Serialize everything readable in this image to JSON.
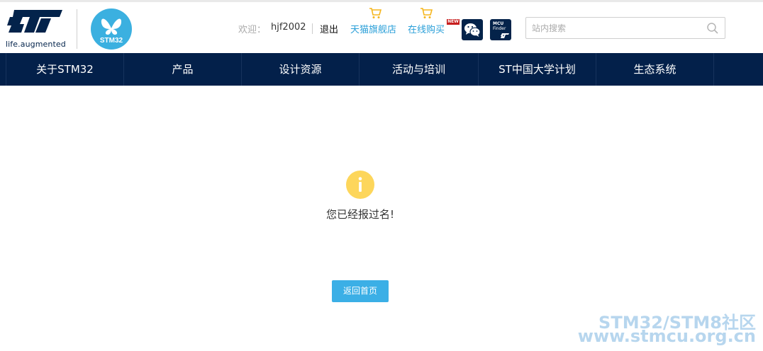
{
  "header": {
    "tagline": "life.augmented",
    "stm_logo_text": "STM32",
    "welcome_label": "欢迎：",
    "username": "hjf2002",
    "logout_label": "退出",
    "shop_links": [
      {
        "label": "天猫旗舰店",
        "icon": "shopping-cart-icon"
      },
      {
        "label": "在线购买",
        "icon": "shopping-cart-icon",
        "badge": "NEW"
      }
    ],
    "wechat_icon": "wechat-icon",
    "mcu_finder_icon": {
      "line1": "MCU",
      "line2": "Finder"
    },
    "search": {
      "placeholder": "站内搜索",
      "value": "",
      "icon": "search-icon"
    }
  },
  "nav": {
    "items": [
      "关于STM32",
      "产品",
      "设计资源",
      "活动与培训",
      "ST中国大学计划",
      "生态系统"
    ]
  },
  "main": {
    "status_icon": "info-icon",
    "message": "您已经报过名!",
    "home_button_label": "返回首页"
  },
  "watermark": {
    "line1": "STM32/STM8社区",
    "line2": "www.stmcu.org.cn"
  },
  "colors": {
    "nav_bg": "#03204a",
    "link": "#2a9fd8",
    "button": "#3bafe6",
    "info_icon": "#fdd65b",
    "cart": "#f5b51c",
    "new_badge": "#c71e1e"
  }
}
